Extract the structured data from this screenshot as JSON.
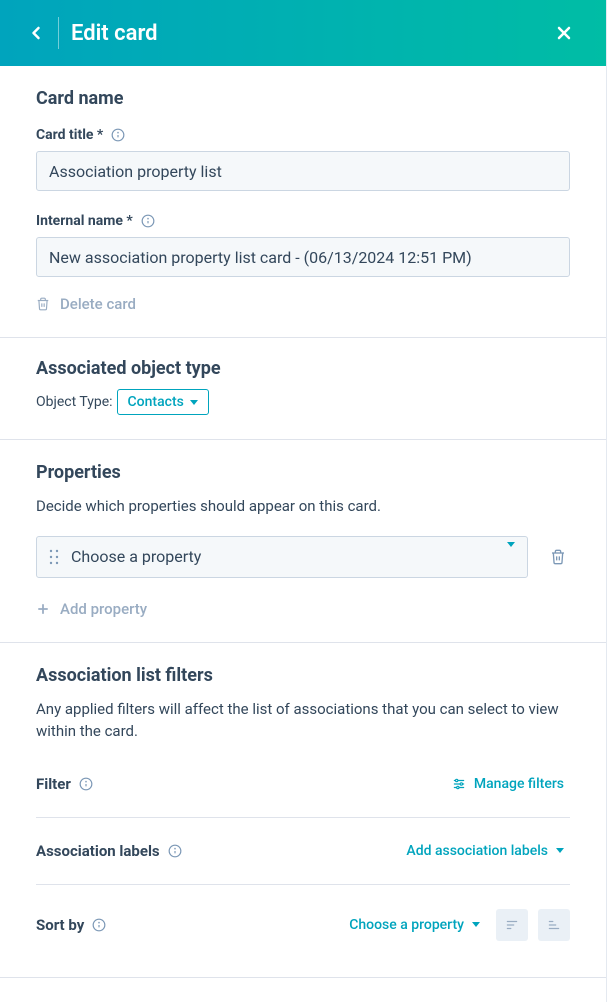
{
  "header": {
    "title": "Edit card"
  },
  "cardName": {
    "section_title": "Card name",
    "title_label": "Card title *",
    "title_value": "Association property list",
    "internal_label": "Internal name *",
    "internal_value": "New association property list card - (06/13/2024 12:51 PM)",
    "delete_label": "Delete card"
  },
  "objectType": {
    "section_title": "Associated object type",
    "label": "Object Type:",
    "value": "Contacts"
  },
  "properties": {
    "section_title": "Properties",
    "desc": "Decide which properties should appear on this card.",
    "select_placeholder": "Choose a property",
    "add_label": "Add property"
  },
  "filters": {
    "section_title": "Association list filters",
    "desc": "Any applied filters will affect the list of associations that you can select to view within the card.",
    "filter_label": "Filter",
    "manage_label": "Manage filters",
    "assoc_labels_label": "Association labels",
    "add_assoc_label": "Add association labels",
    "sort_label": "Sort by",
    "sort_value": "Choose a property"
  }
}
